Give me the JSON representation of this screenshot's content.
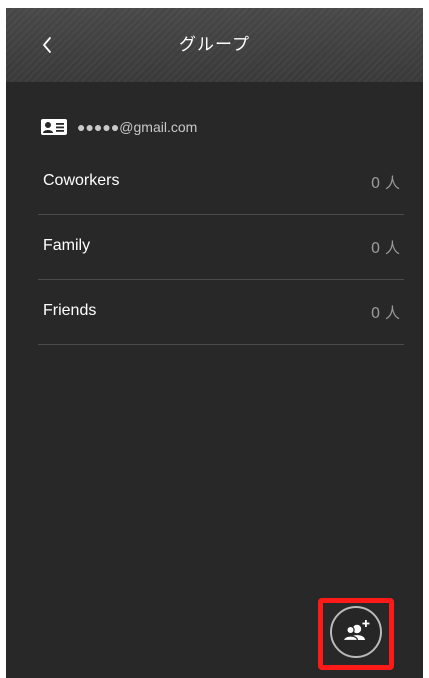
{
  "header": {
    "back_icon": "chevron-left-icon",
    "title": "グループ"
  },
  "account": {
    "icon": "contact-card-icon",
    "email": "●●●●●@gmail.com"
  },
  "groups": [
    {
      "name": "Coworkers",
      "count": "0 人"
    },
    {
      "name": "Family",
      "count": "0 人"
    },
    {
      "name": "Friends",
      "count": "0 人"
    }
  ],
  "fab": {
    "icon": "add-group-icon",
    "highlight_color": "#ff1a1a"
  }
}
